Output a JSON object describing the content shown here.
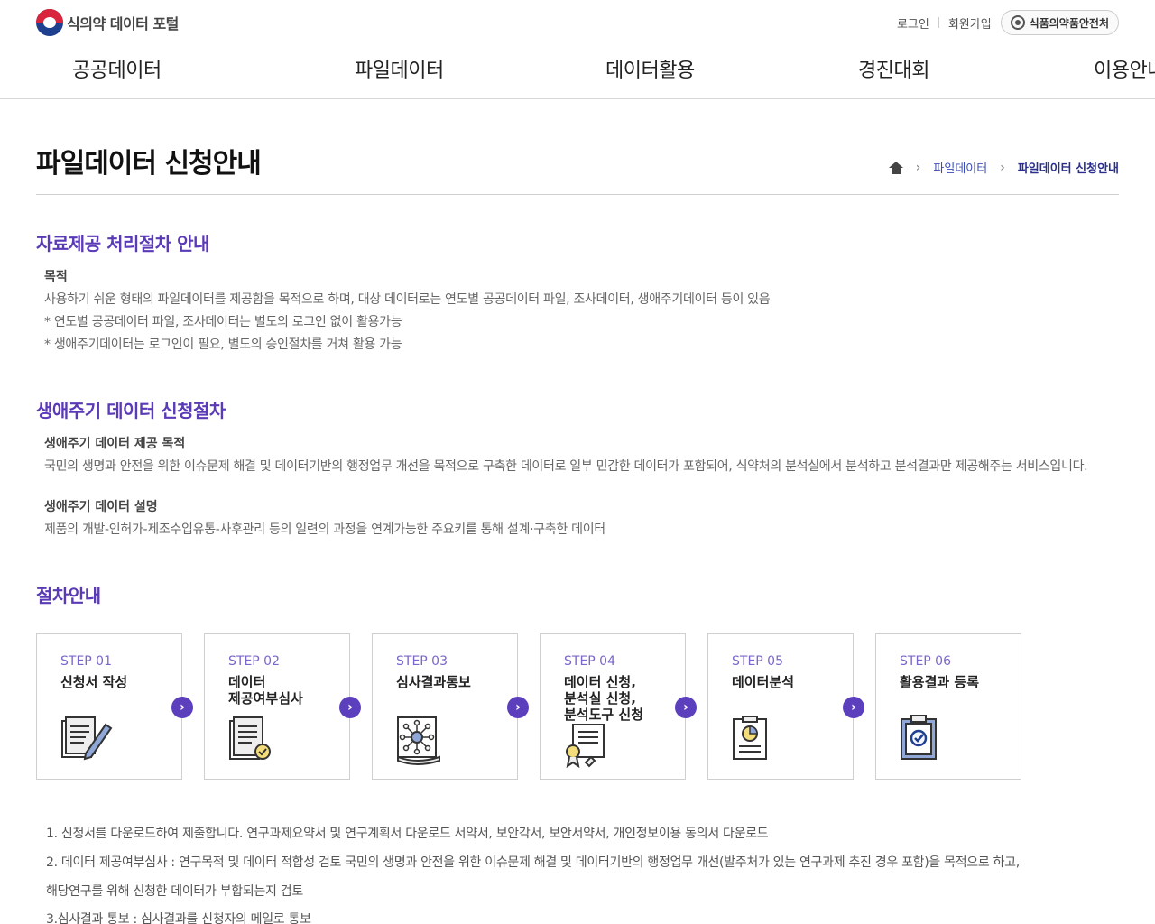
{
  "header": {
    "logo_text": "식의약 데이터 포털",
    "login": "로그인",
    "signup": "회원가입",
    "agency_button": "식품의약품안전처",
    "nav": [
      "공공데이터",
      "파일데이터",
      "데이터활용",
      "경진대회",
      "이용안내"
    ]
  },
  "page": {
    "title": "파일데이터 신청안내",
    "breadcrumb": [
      "파일데이터",
      "파일데이터 신청안내"
    ]
  },
  "section1": {
    "title": "자료제공 처리절차 안내",
    "subtitle": "목적",
    "lines": [
      "사용하기 쉬운 형태의 파일데이터를 제공함을 목적으로 하며, 대상 데이터로는 연도별 공공데이터 파일, 조사데이터, 생애주기데이터 등이 있음",
      "* 연도별 공공데이터 파일, 조사데이터는 별도의 로그인 없이 활용가능",
      "* 생애주기데이터는 로그인이 필요, 별도의 승인절차를 거쳐 활용 가능"
    ]
  },
  "section2": {
    "title": "생애주기 데이터 신청절차",
    "purpose_title": "생애주기 데이터 제공 목적",
    "purpose_text": "국민의 생명과 안전을 위한 이슈문제 해결 및 데이터기반의 행정업무 개선을 목적으로 구축한 데이터로 일부 민감한 데이터가 포함되어, 식약처의 분석실에서 분석하고 분석결과만 제공해주는 서비스입니다.",
    "desc_title": "생애주기 데이터 설명",
    "desc_text": "제품의 개발-인허가-제조수입유통-사후관리 등의 일련의 과정을 연계가능한 주요키를 통해 설계·구축한 데이터"
  },
  "section3": {
    "title": "절차안내",
    "steps": [
      {
        "no": "STEP 01",
        "title": "신청서 작성",
        "icon": "form-writing-icon"
      },
      {
        "no": "STEP 02",
        "title": "데이터\n제공여부심사",
        "icon": "document-check-icon"
      },
      {
        "no": "STEP 03",
        "title": "심사결과통보",
        "icon": "network-notice-icon"
      },
      {
        "no": "STEP 04",
        "title": "데이터 신청,\n분석실 신청,\n분석도구 신청",
        "icon": "certificate-icon"
      },
      {
        "no": "STEP 05",
        "title": "데이터분석",
        "icon": "report-chart-icon"
      },
      {
        "no": "STEP 06",
        "title": "활용결과 등록",
        "icon": "clipboard-check-icon"
      }
    ],
    "notes": [
      "1. 신청서를 다운로드하여 제출합니다. 연구과제요약서 및 연구계획서 다운로드 서약서, 보안각서, 보안서약서, 개인정보이용 동의서 다운로드",
      "2. 데이터 제공여부심사 : 연구목적 및 데이터 적합성 검토 국민의 생명과 안전을 위한 이슈문제 해결 및 데이터기반의 행정업무 개선(발주처가 있는 연구과제 추진 경우 포함)을 목적으로 하고,",
      "해당연구를 위해 신청한 데이터가 부합되는지 검토",
      "3.심사결과 통보 : 심사결과를 신청자의 메일로 통보"
    ]
  },
  "colors": {
    "accent": "#5a3ab7",
    "arrow": "#5b3fbd",
    "step_no": "#7a67c9",
    "breadcrumb": "#3b4cb3"
  }
}
